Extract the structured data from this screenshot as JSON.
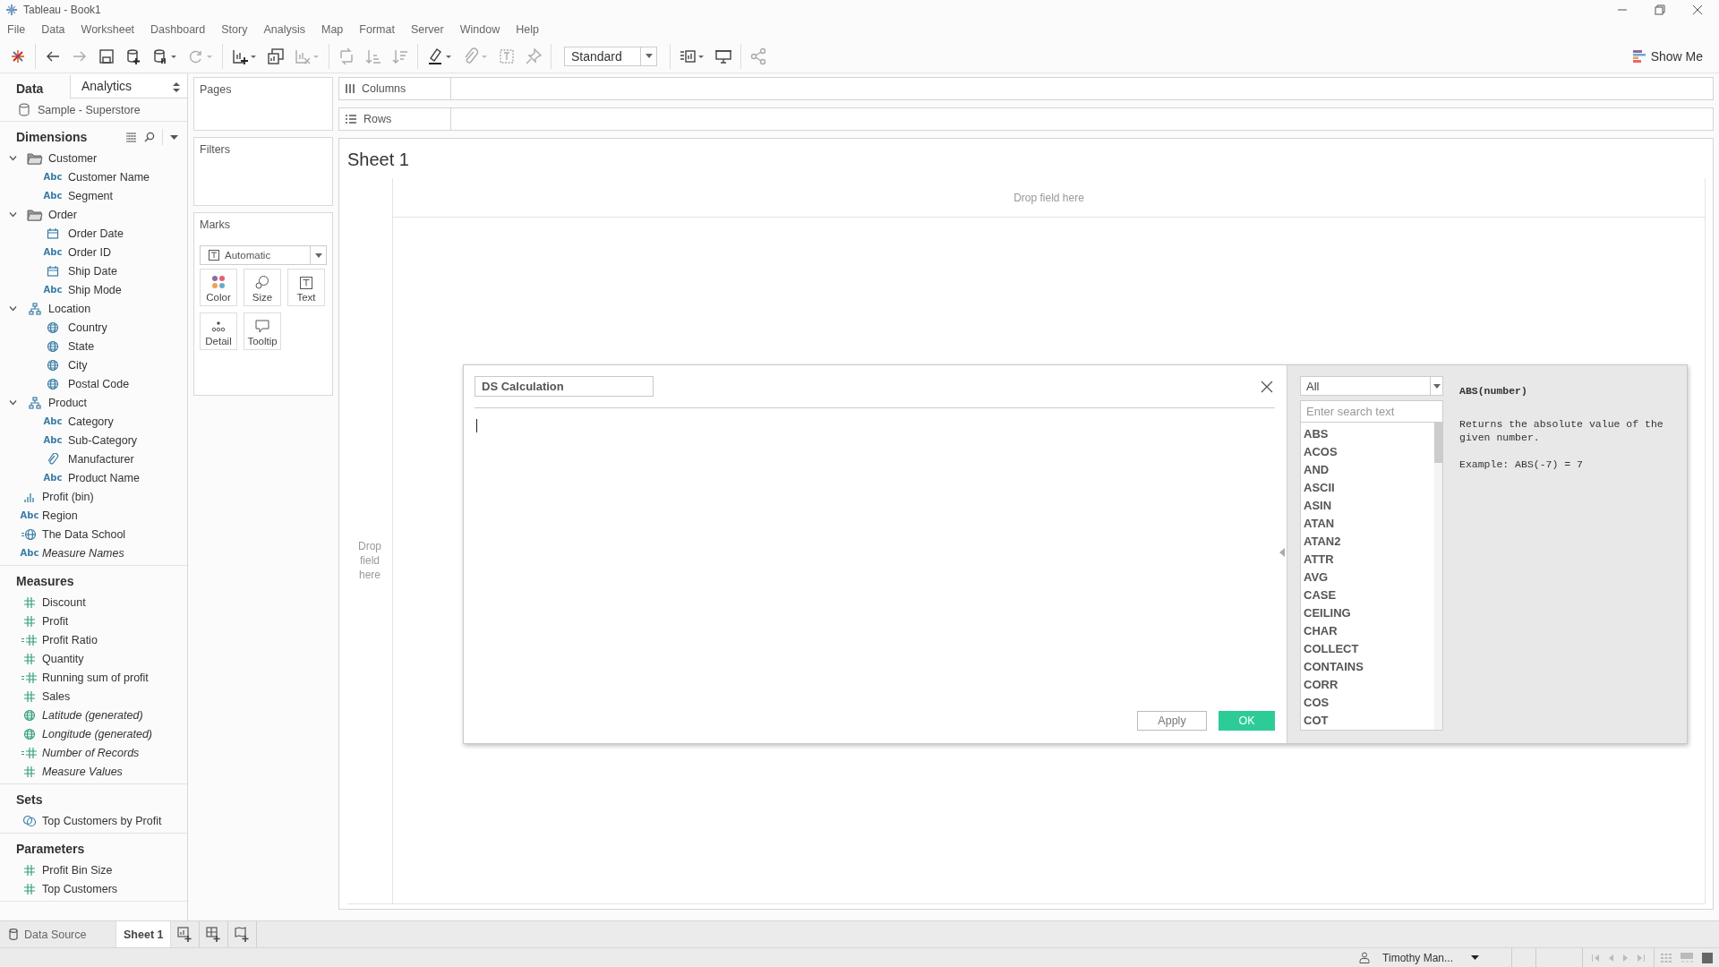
{
  "window": {
    "title": "Tableau - Book1"
  },
  "menu": [
    "File",
    "Data",
    "Worksheet",
    "Dashboard",
    "Story",
    "Analysis",
    "Map",
    "Format",
    "Server",
    "Window",
    "Help"
  ],
  "toolbar": {
    "fit": "Standard",
    "show_me": "Show Me"
  },
  "data_pane": {
    "tabs": [
      {
        "label": "Data",
        "selected": true
      },
      {
        "label": "Analytics",
        "selected": false
      }
    ],
    "datasource": "Sample - Superstore",
    "sections": [
      {
        "title": "Dimensions",
        "kind": "dimension",
        "items": [
          {
            "label": "Customer",
            "kind": "folder",
            "generated": false,
            "expanded": true,
            "children": [
              {
                "label": "Customer Name",
                "kind": "string",
                "type_label": "Abc",
                "generated": false
              },
              {
                "label": "Segment",
                "kind": "string",
                "type_label": "Abc",
                "generated": false
              }
            ]
          },
          {
            "label": "Order",
            "kind": "folder",
            "generated": false,
            "expanded": true,
            "children": [
              {
                "label": "Order Date",
                "kind": "date",
                "generated": false
              },
              {
                "label": "Order ID",
                "kind": "string",
                "type_label": "Abc",
                "generated": false
              },
              {
                "label": "Ship Date",
                "kind": "date",
                "generated": false
              },
              {
                "label": "Ship Mode",
                "kind": "string",
                "type_label": "Abc",
                "generated": false
              }
            ]
          },
          {
            "label": "Location",
            "kind": "hierarchy",
            "generated": false,
            "expanded": true,
            "children": [
              {
                "label": "Country",
                "kind": "geo",
                "generated": false
              },
              {
                "label": "State",
                "kind": "geo",
                "generated": false
              },
              {
                "label": "City",
                "kind": "geo",
                "generated": false
              },
              {
                "label": "Postal Code",
                "kind": "geo",
                "generated": false
              }
            ]
          },
          {
            "label": "Product",
            "kind": "hierarchy",
            "generated": false,
            "expanded": true,
            "children": [
              {
                "label": "Category",
                "kind": "string",
                "type_label": "Abc",
                "generated": false
              },
              {
                "label": "Sub-Category",
                "kind": "string",
                "type_label": "Abc",
                "generated": false
              },
              {
                "label": "Manufacturer",
                "kind": "attachment",
                "generated": false
              },
              {
                "label": "Product Name",
                "kind": "string",
                "type_label": "Abc",
                "generated": false
              }
            ]
          },
          {
            "label": "Profit (bin)",
            "kind": "bin",
            "generated": false
          },
          {
            "label": "Region",
            "kind": "string",
            "type_label": "Abc",
            "generated": false
          },
          {
            "label": "The Data School",
            "kind": "calc-geo",
            "generated": false
          },
          {
            "label": "Measure Names",
            "kind": "string",
            "type_label": "Abc",
            "generated": true
          }
        ]
      },
      {
        "title": "Measures",
        "kind": "measure",
        "items": [
          {
            "label": "Discount",
            "kind": "number",
            "generated": false
          },
          {
            "label": "Profit",
            "kind": "number",
            "generated": false
          },
          {
            "label": "Profit Ratio",
            "kind": "calc-number",
            "generated": false
          },
          {
            "label": "Quantity",
            "kind": "number",
            "generated": false
          },
          {
            "label": "Running sum of profit",
            "kind": "calc-number",
            "generated": false
          },
          {
            "label": "Sales",
            "kind": "number",
            "generated": false
          },
          {
            "label": "Latitude (generated)",
            "kind": "geo",
            "generated": true
          },
          {
            "label": "Longitude (generated)",
            "kind": "geo",
            "generated": true
          },
          {
            "label": "Number of Records",
            "kind": "calc-number",
            "generated": true
          },
          {
            "label": "Measure Values",
            "kind": "number",
            "generated": true
          }
        ]
      },
      {
        "title": "Sets",
        "kind": "dimension",
        "items": [
          {
            "label": "Top Customers by Profit",
            "kind": "set",
            "generated": false
          }
        ]
      },
      {
        "title": "Parameters",
        "kind": "measure",
        "items": [
          {
            "label": "Profit Bin Size",
            "kind": "number",
            "generated": false
          },
          {
            "label": "Top Customers",
            "kind": "number",
            "generated": false
          }
        ]
      }
    ]
  },
  "shelves": {
    "pages": "Pages",
    "filters": "Filters",
    "marks": {
      "title": "Marks",
      "mark_type": "Automatic",
      "cards": [
        {
          "label": "Color",
          "kind": "color"
        },
        {
          "label": "Size",
          "kind": "size"
        },
        {
          "label": "Text",
          "kind": "text"
        },
        {
          "label": "Detail",
          "kind": "detail"
        },
        {
          "label": "Tooltip",
          "kind": "tooltip"
        }
      ]
    }
  },
  "columns_shelf": "Columns",
  "rows_shelf": "Rows",
  "sheet": {
    "title": "Sheet 1",
    "drop_top": "Drop field here",
    "drop_left": "Drop field here"
  },
  "calc_dialog": {
    "name": "DS Calculation",
    "category": "All",
    "search_placeholder": "Enter search text",
    "functions": [
      "ABS",
      "ACOS",
      "AND",
      "ASCII",
      "ASIN",
      "ATAN",
      "ATAN2",
      "ATTR",
      "AVG",
      "CASE",
      "CEILING",
      "CHAR",
      "COLLECT",
      "CONTAINS",
      "CORR",
      "COS",
      "COT"
    ],
    "help": {
      "signature": "ABS(number)",
      "description": "Returns the absolute value of the given number.",
      "example": "Example: ABS(-7) = 7"
    },
    "buttons": [
      {
        "label": "Apply",
        "kind": "secondary"
      },
      {
        "label": "OK",
        "kind": "primary"
      }
    ]
  },
  "sheet_tabs": {
    "data_source": "Data Source",
    "sheets": [
      {
        "label": "Sheet 1",
        "selected": true
      }
    ]
  },
  "status_bar": {
    "user": "Timothy Man..."
  }
}
